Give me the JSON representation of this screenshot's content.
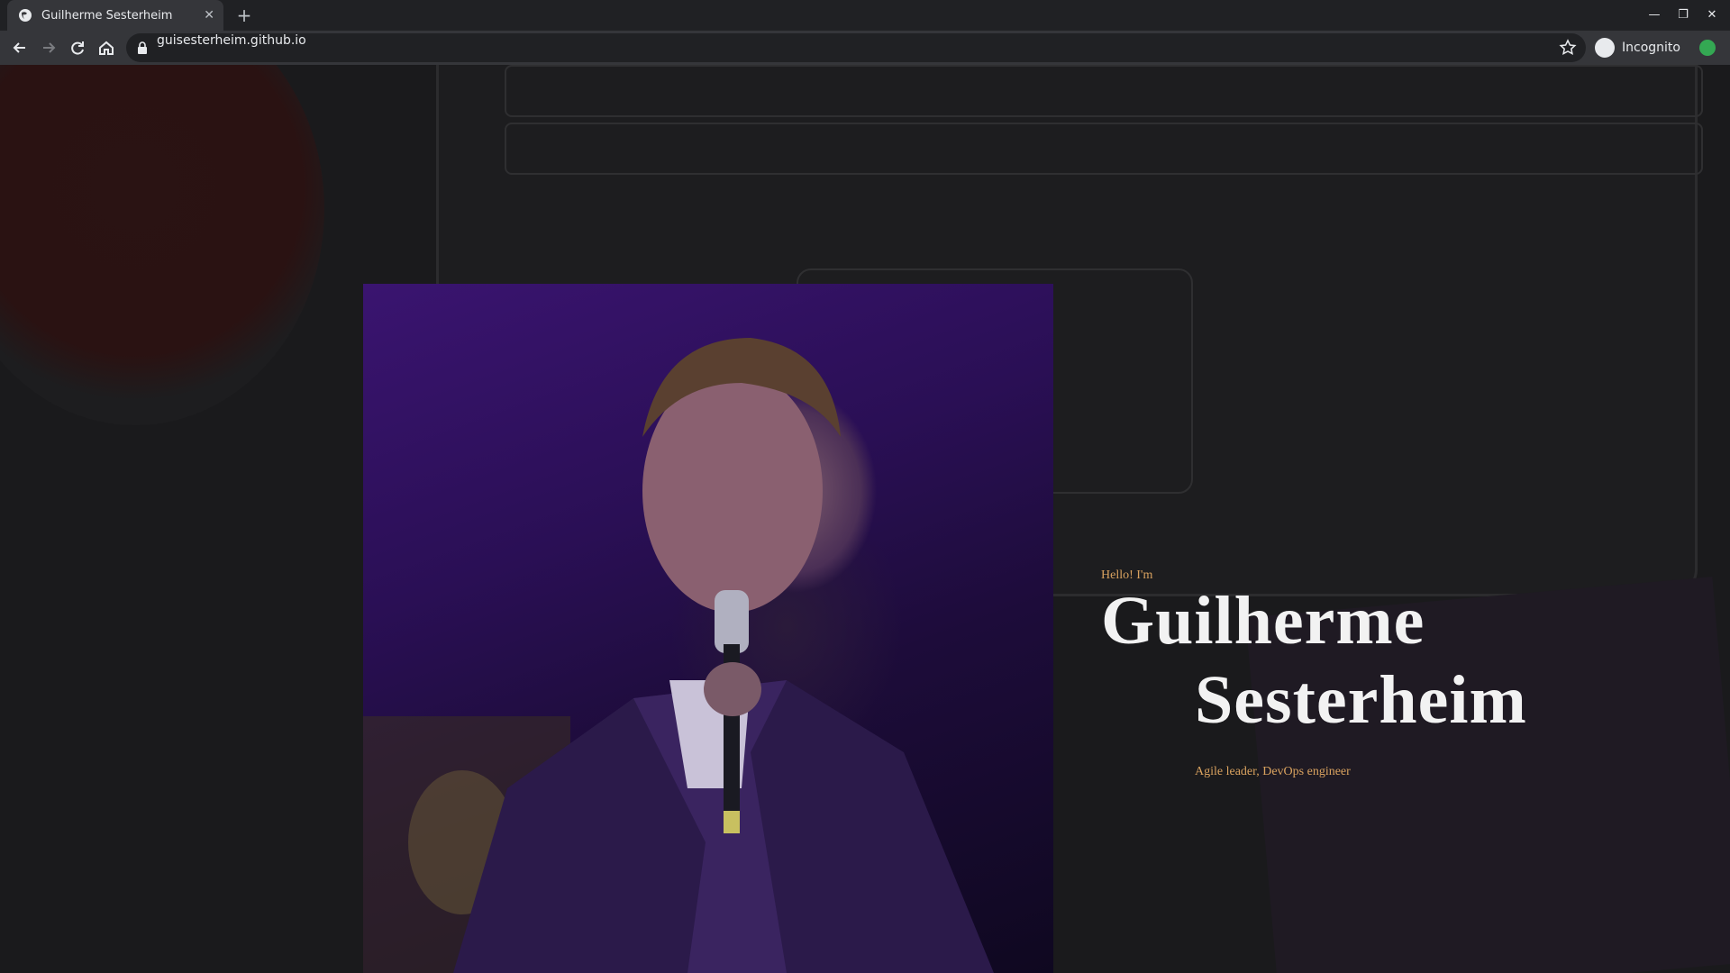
{
  "browser": {
    "tab_title": "Guilherme Sesterheim",
    "new_tab_label": "+",
    "url": "guisesterheim.github.io",
    "profile_label": "Incognito"
  },
  "hero": {
    "greeting": "Hello! I'm",
    "first_name": "Guilherme",
    "last_name": "Sesterheim",
    "tagline": "Agile leader, DevOps engineer"
  },
  "colors": {
    "accent": "#d9a25f",
    "heading": "#f2f2f2",
    "photo_tint": "#3a1470"
  }
}
